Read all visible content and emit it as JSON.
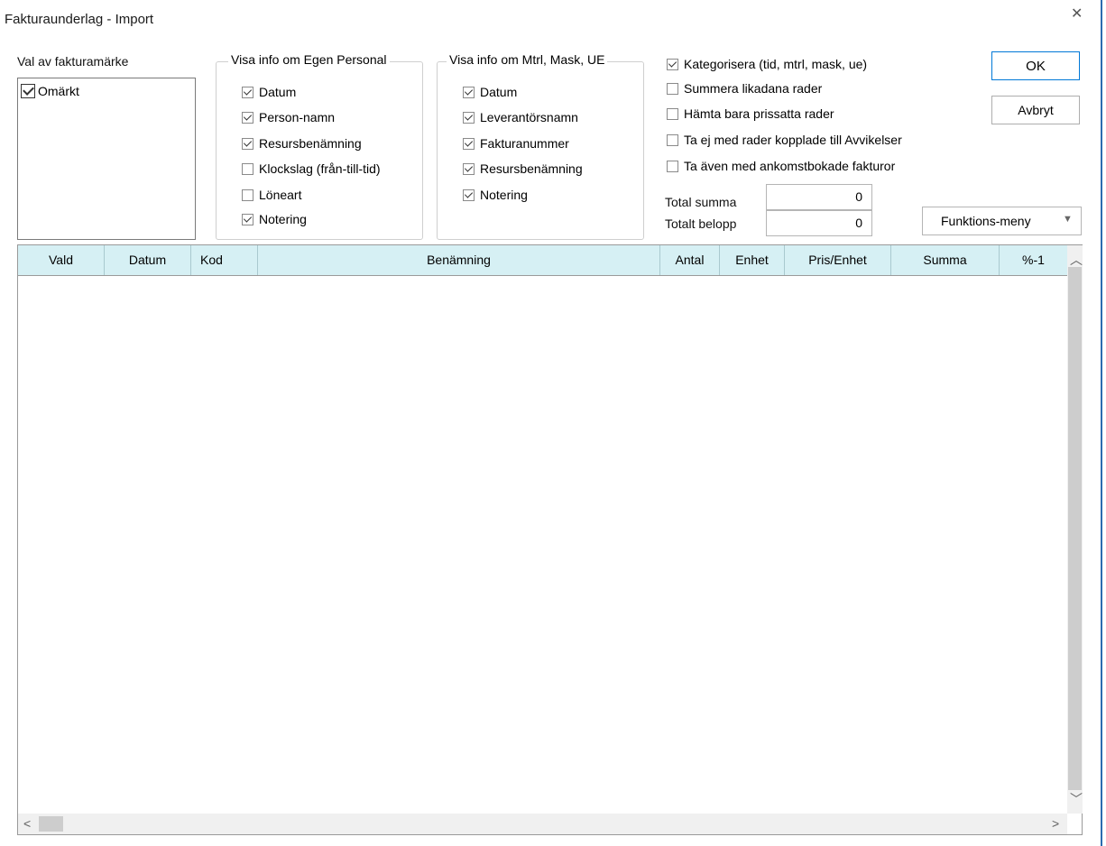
{
  "window": {
    "title": "Fakturaunderlag - Import"
  },
  "marks": {
    "label": "Val av fakturamärke",
    "items": [
      {
        "label": "Omärkt",
        "checked": true
      }
    ]
  },
  "personal": {
    "legend": "Visa info om Egen Personal",
    "items": [
      {
        "label": "Datum",
        "checked": true
      },
      {
        "label": "Person-namn",
        "checked": true
      },
      {
        "label": "Resursbenämning",
        "checked": true
      },
      {
        "label": "Klockslag (från-till-tid)",
        "checked": false
      },
      {
        "label": "Löneart",
        "checked": false
      },
      {
        "label": "Notering",
        "checked": true
      }
    ]
  },
  "material": {
    "legend": "Visa info om Mtrl, Mask, UE",
    "items": [
      {
        "label": "Datum",
        "checked": true
      },
      {
        "label": "Leverantörsnamn",
        "checked": true
      },
      {
        "label": "Fakturanummer",
        "checked": true
      },
      {
        "label": "Resursbenämning",
        "checked": true
      },
      {
        "label": "Notering",
        "checked": true
      }
    ]
  },
  "options": [
    {
      "label": "Kategorisera (tid, mtrl, mask, ue)",
      "checked": true
    },
    {
      "label": "Summera likadana rader",
      "checked": false
    },
    {
      "label": "Hämta bara prissatta rader",
      "checked": false
    },
    {
      "label": "Ta ej med rader kopplade till Avvikelser",
      "checked": false
    },
    {
      "label": "Ta även med ankomstbokade fakturor",
      "checked": false
    }
  ],
  "totals": {
    "summa_label": "Total summa",
    "summa_value": "0",
    "belopp_label": "Totalt belopp",
    "belopp_value": "0"
  },
  "buttons": {
    "ok": "OK",
    "cancel": "Avbryt"
  },
  "menu": {
    "label": "Funktions-meny"
  },
  "grid": {
    "columns": [
      "Vald",
      "Datum",
      "Kod",
      "Benämning",
      "Antal",
      "Enhet",
      "Pris/Enhet",
      "Summa",
      "%-1"
    ],
    "rows": []
  }
}
